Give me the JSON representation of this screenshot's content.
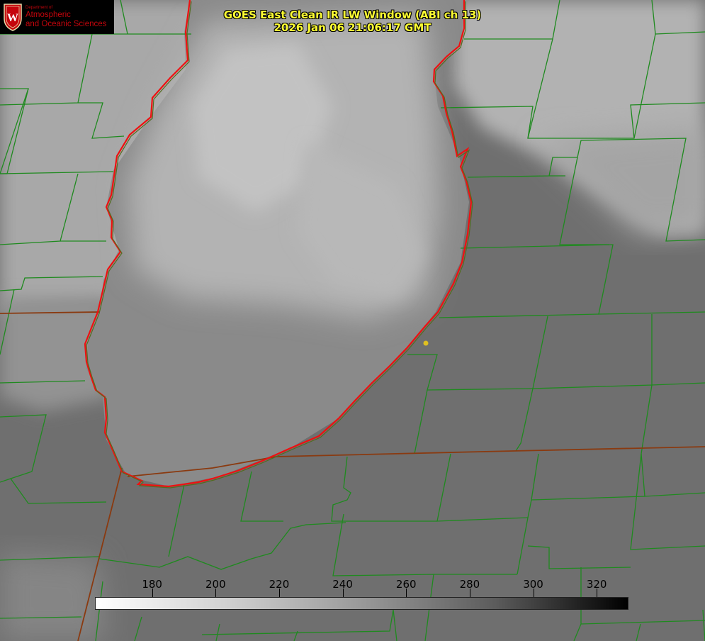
{
  "title": {
    "line1": "GOES East Clean IR LW Window (ABI ch 13)",
    "line2": "2026 Jan 06 21:06:17 GMT"
  },
  "logo": {
    "department": "Department of",
    "line1": "Atmospheric",
    "line2": "and Oceanic Sciences",
    "seal_letter": "W"
  },
  "colorbar": {
    "min": 162,
    "max": 330,
    "ticks": [
      180,
      200,
      220,
      240,
      260,
      280,
      300,
      320
    ],
    "ramp": "white-to-black"
  },
  "colors": {
    "lake_outline": "#ee1111",
    "county_lines": "#1f8a1f",
    "state_lines": "#8a3a10",
    "title_text": "#ffff33",
    "city_marker": "#e0c020"
  }
}
